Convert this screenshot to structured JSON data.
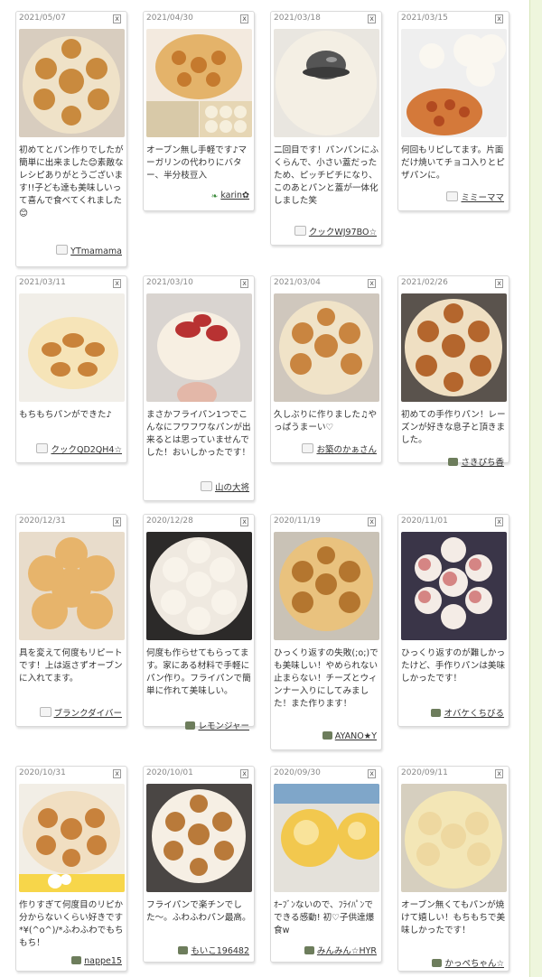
{
  "close_label": "x",
  "colors": {
    "accent": "#ffffff",
    "link": "#333333",
    "scrollbar": "#eef6dd"
  },
  "reports": [
    {
      "date": "2021/05/07",
      "comment": "初めてとパン作りでしたが簡単に出来ました😊素敵なレシピありがとうございます!!子ども達も美味しいって喜んで食べてくれました😊",
      "author": "YTmamama",
      "avatar_icon": "cup-icon"
    },
    {
      "date": "2021/04/30",
      "comment": "オーブン無し手軽です♪マーガリンの代わりにバター、半分枝豆入",
      "author": "karin✿",
      "avatar_icon": "leaf-icon"
    },
    {
      "date": "2021/03/18",
      "comment": "二回目です！パンパンにふくらんで、小さい蓋だったため、ピッチピチになり、このあとパンと蓋が一体化しました笑",
      "author": "クックWJ97BO☆",
      "avatar_icon": "cup-icon"
    },
    {
      "date": "2021/03/15",
      "comment": "何回もリピしてます。片面だけ焼いてチョコ入りとピザパンに。",
      "author": "ミミーママ",
      "avatar_icon": "cup-icon"
    },
    {
      "date": "2021/03/11",
      "comment": "もちもちパンができた♪",
      "author": "クックQD2QH4☆",
      "avatar_icon": "cup-icon"
    },
    {
      "date": "2021/03/10",
      "comment": "まさかフライパン1つでこんなにフワフワなパンが出来るとは思っていませんでした！おいしかったです！",
      "author": "山の大将",
      "avatar_icon": "cup-icon"
    },
    {
      "date": "2021/03/04",
      "comment": "久しぶりに作りました♫やっぱうまーい♡",
      "author": "お築のかぁさん",
      "avatar_icon": "cup-icon"
    },
    {
      "date": "2021/02/26",
      "comment": "初めての手作りパン！レーズンが好きな息子と頂きました。",
      "author": "さきぴち香",
      "avatar_icon": "photo-avatar"
    },
    {
      "date": "2020/12/31",
      "comment": "具を変えて何度もリピートです！上は返さずオーブンに入れてます。",
      "author": "ブランクダイバー",
      "avatar_icon": "cup-icon"
    },
    {
      "date": "2020/12/28",
      "comment": "何度も作らせてもらってます。家にある材料で手軽にパン作り。フライパンで簡単に作れて美味しい。",
      "author": "レモンジャー",
      "avatar_icon": "photo-avatar"
    },
    {
      "date": "2020/11/19",
      "comment": "ひっくり返すの失敗(;o;)でも美味しい！やめられない止まらない！チーズとウィンナー入りにしてみました！また作ります！",
      "author": "AYANO★Y",
      "avatar_icon": "photo-avatar"
    },
    {
      "date": "2020/11/01",
      "comment": "ひっくり返すのが難しかったけど、手作りパンは美味しかったです！",
      "author": "オバケくちびる",
      "avatar_icon": "photo-avatar"
    },
    {
      "date": "2020/10/31",
      "comment": "作りすぎて何度目のリピか分からないくらい好きです*¥(^o^)/*ふわふわでもちもち！",
      "author": "nappe15",
      "avatar_icon": "photo-avatar"
    },
    {
      "date": "2020/10/01",
      "comment": "フライパンで楽チンでした〜。ふわふわパン最高。",
      "author": "もいこ196482",
      "avatar_icon": "photo-avatar"
    },
    {
      "date": "2020/09/30",
      "comment": "ｵｰﾌﾞﾝないので、ﾌﾗｲﾊﾟﾝでできる感動! 初♡子供達爆食w",
      "author": "みんみん☆HYR",
      "avatar_icon": "photo-avatar"
    },
    {
      "date": "2020/09/11",
      "comment": "オーブン無くてもパンが焼けて嬉しい！もちもちで美味しかったです！",
      "author": "かっぺちゃん☆",
      "avatar_icon": "photo-avatar"
    }
  ]
}
